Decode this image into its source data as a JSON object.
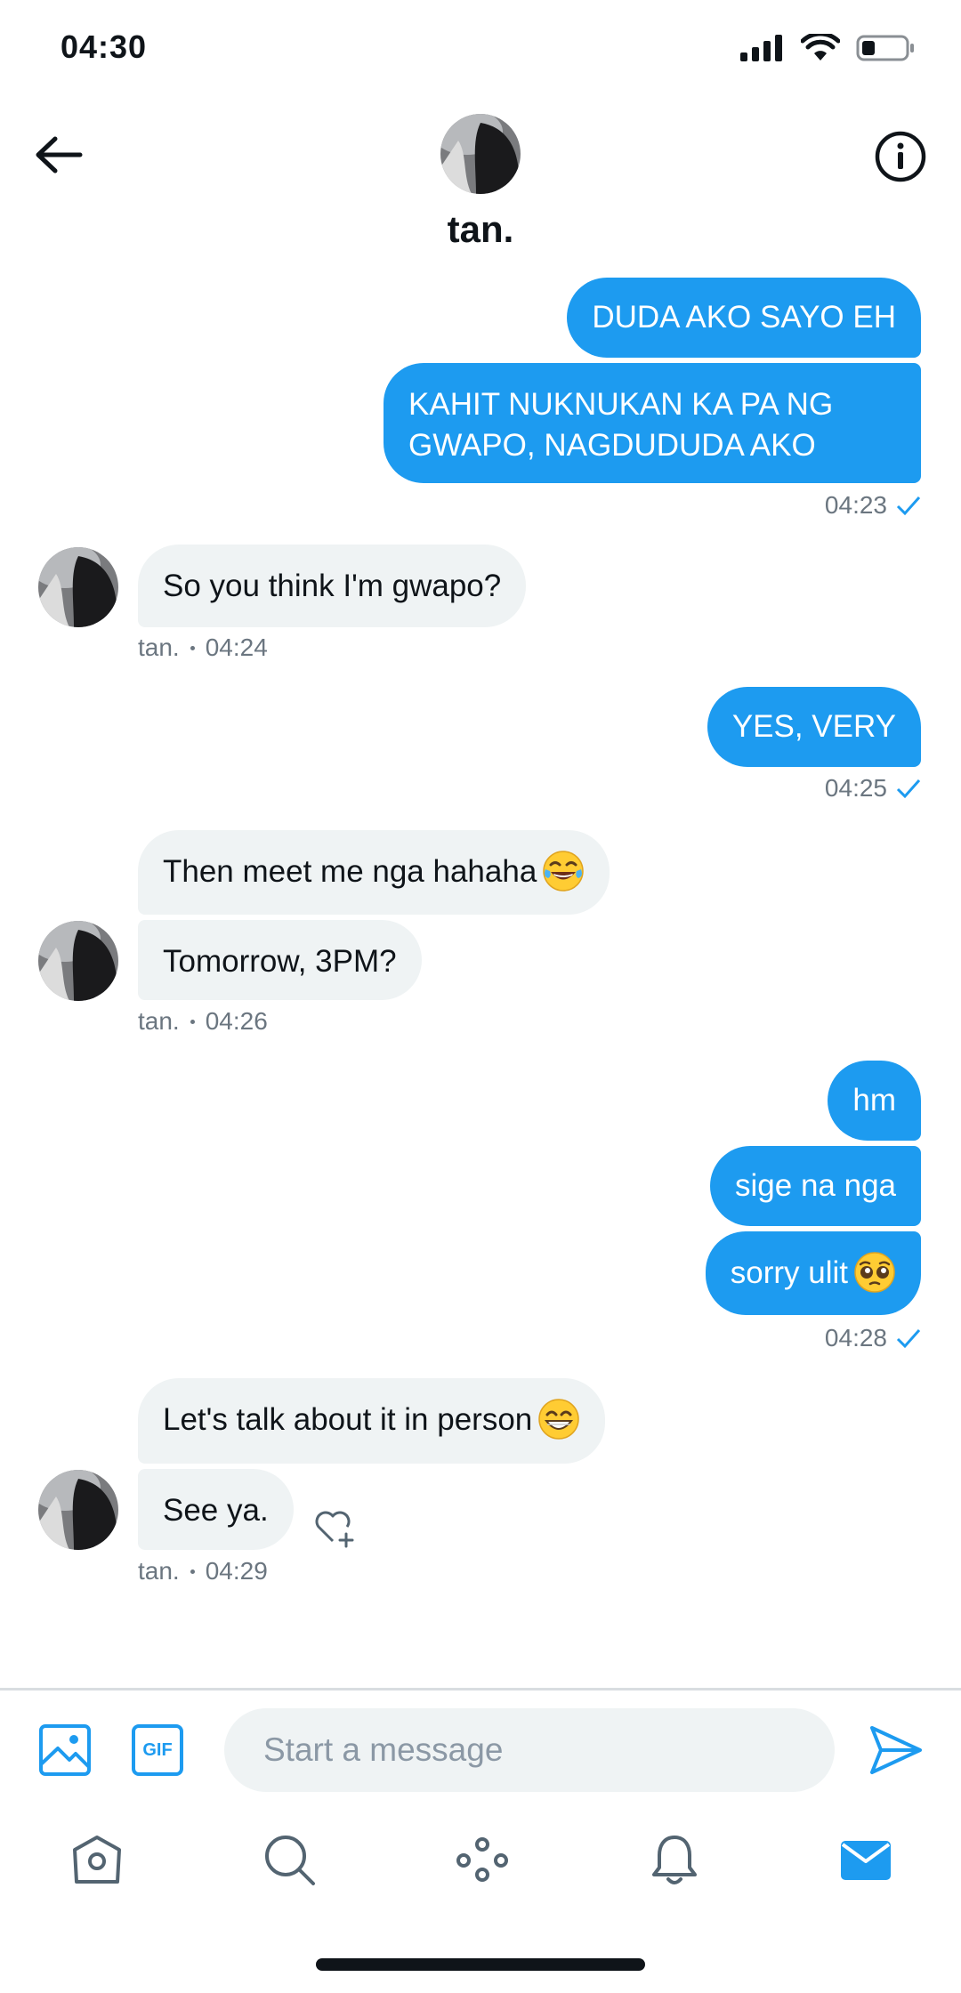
{
  "status": {
    "time": "04:30"
  },
  "header": {
    "name": "tan."
  },
  "messages": {
    "m1": "DUDA AKO SAYO EH",
    "m2_line1": "KAHIT NUKNUKAN KA PA NG",
    "m2_line2": "GWAPO, NAGDUDUDA AKO",
    "t1": "04:23",
    "m3": "So you think I'm gwapo?",
    "s1": "tan.",
    "t2": "04:24",
    "m4": "YES, VERY",
    "t3": "04:25",
    "m5": "Then meet me nga hahaha",
    "m6": "Tomorrow, 3PM?",
    "s2": "tan.",
    "t4": "04:26",
    "m7": "hm",
    "m8": "sige na nga",
    "m9": "sorry ulit",
    "t5": "04:28",
    "m10": "Let's talk about it in person",
    "m11": "See ya.",
    "s3": "tan.",
    "t6": "04:29"
  },
  "compose": {
    "placeholder": "Start a message",
    "gif_label": "GIF"
  },
  "colors": {
    "accent": "#1d9bf0",
    "incoming_bubble": "#eff3f4",
    "meta_text": "#6b7680"
  },
  "icons": {
    "back": "arrow-left-icon",
    "info": "info-icon",
    "image": "image-icon",
    "gif": "gif-icon",
    "send": "send-icon",
    "react": "heart-plus-icon",
    "tabs": [
      "home-icon",
      "search-icon",
      "spaces-icon",
      "bell-icon",
      "mail-icon"
    ]
  }
}
